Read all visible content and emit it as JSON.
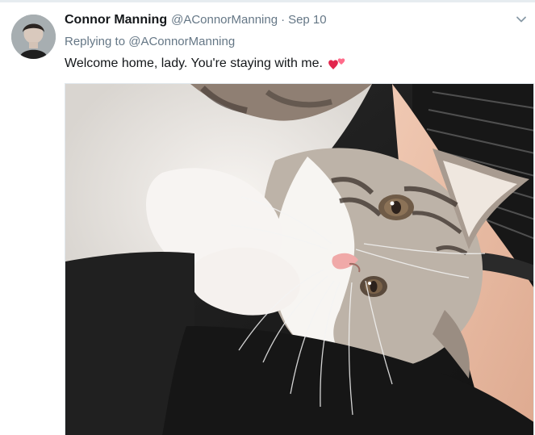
{
  "tweet": {
    "author_name": "Connor Manning",
    "author_handle": "@AConnorManning",
    "separator": "·",
    "timestamp": "Sep 10",
    "replying_prefix": "Replying to",
    "replying_to_handle": "@AConnorManning",
    "text": "Welcome home, lady. You're staying with me."
  },
  "icons": {
    "avatar": "avatar",
    "heart_emoji": "two-hearts-icon",
    "menu": "chevron-down-icon"
  },
  "media": {
    "description_icon": "photo",
    "image_name": "photo"
  },
  "colors": {
    "name": "#14171a",
    "secondary": "#657786",
    "border": "#e1e8ed",
    "heart": "#e2264d"
  }
}
